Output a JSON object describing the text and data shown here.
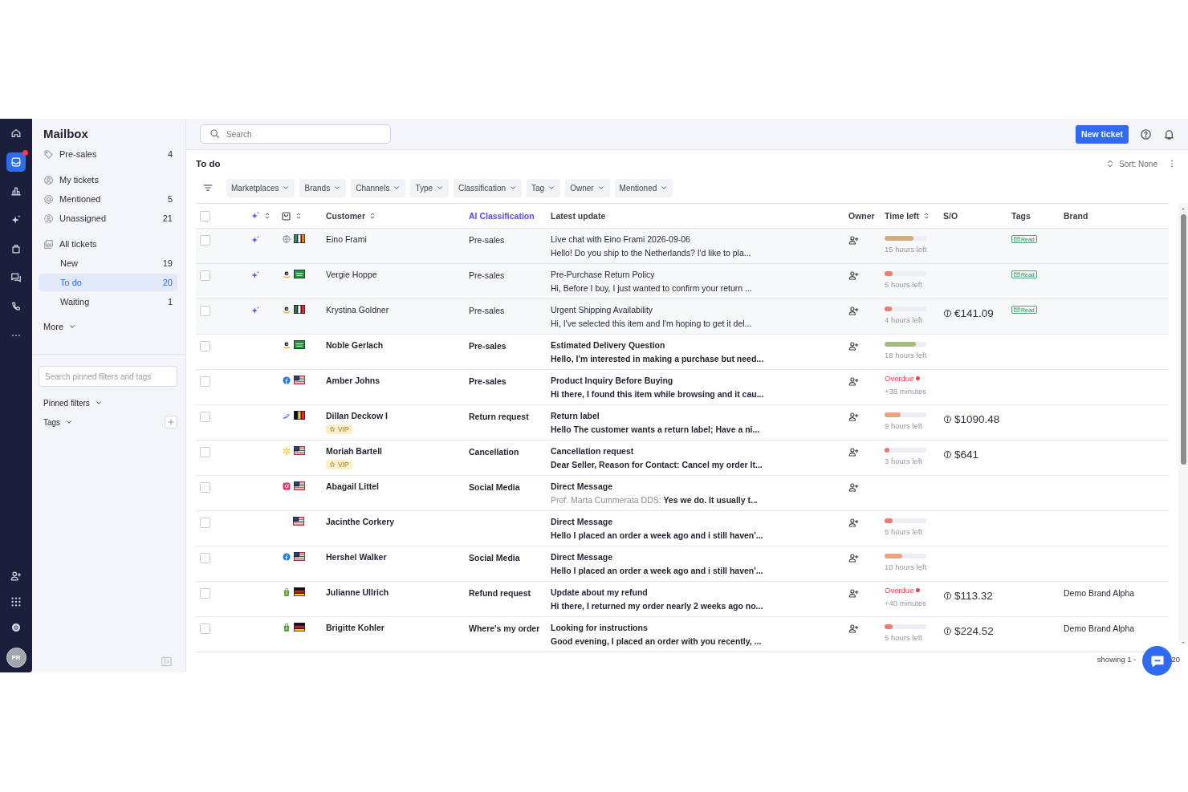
{
  "nav": {
    "items": [
      {
        "kind": "home",
        "selected": false,
        "badge": false
      },
      {
        "kind": "inbox",
        "selected": true,
        "badge": true
      },
      {
        "kind": "chart",
        "selected": false,
        "badge": false
      },
      {
        "kind": "sparkle",
        "selected": false,
        "badge": false
      },
      {
        "kind": "bag",
        "selected": false,
        "badge": false
      },
      {
        "kind": "chat",
        "selected": false,
        "badge": false
      },
      {
        "kind": "phone",
        "selected": false,
        "badge": false
      },
      {
        "kind": "more",
        "selected": false,
        "badge": false
      }
    ],
    "bottom": [
      {
        "kind": "userplus"
      },
      {
        "kind": "grid"
      },
      {
        "kind": "gear"
      }
    ],
    "avatar": "PR"
  },
  "sidebar": {
    "title": "Mailbox",
    "sections": [
      {
        "items": [
          {
            "kind": "tag",
            "label": "Pre-sales",
            "count": "4",
            "selected": false
          }
        ]
      },
      {
        "items": [
          {
            "kind": "person",
            "label": "My tickets",
            "selected": false
          },
          {
            "kind": "at",
            "label": "Mentioned",
            "count": "5",
            "selected": false
          },
          {
            "kind": "unassigned",
            "label": "Unassigned",
            "count": "21",
            "selected": false
          }
        ]
      },
      {
        "items": [
          {
            "kind": "stack",
            "label": "All tickets",
            "selected": false,
            "children": [
              {
                "label": "New",
                "count": "19",
                "selected": false
              },
              {
                "label": "To do",
                "count": "20",
                "selected": true
              },
              {
                "label": "Waiting",
                "count": "1",
                "selected": false
              }
            ]
          }
        ]
      }
    ],
    "more": "More",
    "search_placeholder": "Search pinned filters and tags",
    "pinned_filters": "Pinned filters",
    "tags": "Tags"
  },
  "topbar": {
    "search_placeholder": "Search",
    "new_ticket": "New ticket"
  },
  "view": {
    "title": "To do",
    "sort": "Sort: None",
    "filters": [
      "Marketplaces",
      "Brands",
      "Channels",
      "Type",
      "Classification",
      "Tag",
      "Owner",
      "Mentioned"
    ]
  },
  "table": {
    "select_all_checked": false,
    "columns": {
      "customer": "Customer",
      "classification": "AI Classification",
      "latest_update": "Latest update",
      "owner": "Owner",
      "time_left": "Time left",
      "so": "S/O",
      "tags": "Tags",
      "brand": "Brand"
    },
    "rows": [
      {
        "checked": false,
        "ai": true,
        "channel": {
          "kind": "web"
        },
        "flag": {
          "kind": "ie"
        },
        "customer": "Eino Frami",
        "classification": "Pre-sales",
        "subject": "Live chat with Eino Frami 2026-09-06",
        "preview": "Hello! Do you ship to the Netherlands? I'd like to pla...",
        "unread": false,
        "time_left": {
          "kind": "bar",
          "level": 0.7,
          "color": "#d4ad78",
          "text": "15 hours left"
        },
        "tag": "Read"
      },
      {
        "checked": false,
        "ai": true,
        "channel": {
          "kind": "amazon"
        },
        "flag": {
          "kind": "sa"
        },
        "customer": "Vergie Hoppe",
        "classification": "Pre-sales",
        "subject": "Pre-Purchase Return Policy",
        "preview": "Hi, Before I buy, I just wanted to confirm your return ...",
        "unread": false,
        "time_left": {
          "kind": "bar",
          "level": 0.2,
          "color": "#ee7b73",
          "text": "5 hours left"
        },
        "tag": "Read"
      },
      {
        "checked": false,
        "ai": true,
        "channel": {
          "kind": "amazon"
        },
        "flag": {
          "kind": "it"
        },
        "customer": "Krystina Goldner",
        "classification": "Pre-sales",
        "subject": "Urgent Shipping Availability",
        "preview": "Hi, I've selected this item and I'm hoping to get it del...",
        "unread": false,
        "time_left": {
          "kind": "bar",
          "level": 0.17,
          "color": "#ee7b73",
          "text": "4 hours left"
        },
        "so": "€141.09",
        "tag": "Read"
      },
      {
        "checked": false,
        "ai": false,
        "channel": {
          "kind": "amazon"
        },
        "flag": {
          "kind": "sa"
        },
        "customer": "Noble Gerlach",
        "classification": "Pre-sales",
        "subject": "Estimated Delivery Question",
        "preview": "Hello, I'm interested in making a purchase but need...",
        "unread": true,
        "time_left": {
          "kind": "bar",
          "level": 0.75,
          "color": "#a9b97f",
          "text": "18 hours left"
        }
      },
      {
        "checked": false,
        "ai": false,
        "channel": {
          "kind": "facebook"
        },
        "flag": {
          "kind": "us"
        },
        "customer": "Amber Johns",
        "classification": "Pre-sales",
        "subject": "Product Inquiry Before Buying",
        "preview": "Hi there, I found this item while browsing and it cau...",
        "unread": true,
        "time_left": {
          "kind": "overdue",
          "label": "Overdue",
          "text": "+38 minutes"
        }
      },
      {
        "checked": false,
        "ai": false,
        "channel": {
          "kind": "swoosh"
        },
        "flag": {
          "kind": "be"
        },
        "customer": "Dillan Deckow I",
        "vip": "VIP",
        "classification": "Return request",
        "subject": "Return label",
        "preview": "Hello The customer wants a return label; Have a ni...",
        "unread": true,
        "time_left": {
          "kind": "bar",
          "level": 0.38,
          "color": "#f0a07c",
          "text": "9 hours left"
        },
        "so": "$1090.48"
      },
      {
        "checked": false,
        "ai": false,
        "channel": {
          "kind": "walmart"
        },
        "flag": {
          "kind": "us"
        },
        "customer": "Moriah Bartell",
        "vip": "VIP",
        "classification": "Cancellation",
        "subject": "Cancellation request",
        "preview": "Dear Seller, Reason for Contact: Cancel my order It...",
        "unread": true,
        "time_left": {
          "kind": "bar",
          "level": 0.12,
          "color": "#ee7b73",
          "text": "3 hours left"
        },
        "so": "$641"
      },
      {
        "checked": false,
        "ai": false,
        "channel": {
          "kind": "instagram"
        },
        "flag": {
          "kind": "us"
        },
        "customer": "Abagail Littel",
        "classification": "Social Media",
        "subject": "Direct Message",
        "preview_author": "Prof. Marta Cummerata DDS:",
        "preview": "Yes we do. It usually t...",
        "unread": true
      },
      {
        "checked": false,
        "ai": false,
        "flag": {
          "kind": "us"
        },
        "customer": "Jacinthe Corkery",
        "subject": "Direct Message",
        "preview": "Hello I placed an order a week ago and i still haven'...",
        "unread": true,
        "time_left": {
          "kind": "bar",
          "level": 0.2,
          "color": "#ee7b73",
          "text": "5 hours left"
        }
      },
      {
        "checked": false,
        "ai": false,
        "channel": {
          "kind": "facebook"
        },
        "flag": {
          "kind": "us"
        },
        "customer": "Hershel Walker",
        "classification": "Social Media",
        "subject": "Direct Message",
        "preview": "Hello I placed an order a week ago and i still haven'...",
        "unread": true,
        "time_left": {
          "kind": "bar",
          "level": 0.42,
          "color": "#f0a07c",
          "text": "10 hours left"
        }
      },
      {
        "checked": false,
        "ai": false,
        "channel": {
          "kind": "shopify"
        },
        "flag": {
          "kind": "de"
        },
        "customer": "Julianne Ullrich",
        "classification": "Refund request",
        "subject": "Update about my refund",
        "preview": "Hi there, I returned my order nearly 2 weeks ago no...",
        "unread": true,
        "time_left": {
          "kind": "overdue",
          "label": "Overdue",
          "text": "+40 minutes"
        },
        "so": "$113.32",
        "brand": "Demo Brand Alpha"
      },
      {
        "checked": false,
        "ai": false,
        "channel": {
          "kind": "shopify"
        },
        "flag": {
          "kind": "de"
        },
        "customer": "Brigitte Kohler",
        "classification": "Where's my order",
        "subject": "Looking for instructions",
        "preview": "Good evening, I placed an order with you recently, ...",
        "unread": true,
        "time_left": {
          "kind": "bar",
          "level": 0.2,
          "color": "#ee7b73",
          "text": "5 hours left"
        },
        "so": "$224.52",
        "brand": "Demo Brand Alpha"
      }
    ]
  },
  "footer": {
    "showing": "showing 1 -",
    "total": "20"
  }
}
